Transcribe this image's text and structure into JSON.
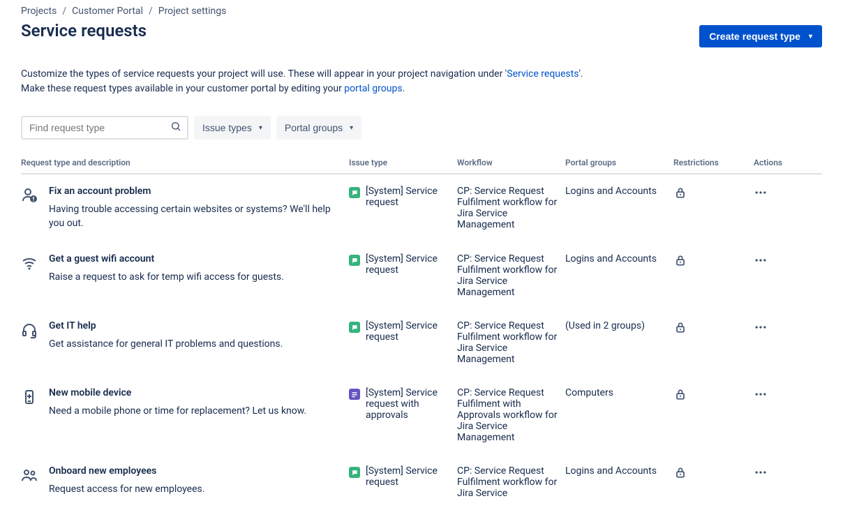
{
  "breadcrumb": {
    "projects": "Projects",
    "portal": "Customer Portal",
    "settings": "Project settings"
  },
  "page": {
    "title": "Service requests",
    "create_button": "Create request type",
    "desc_part1": "Customize the types of service requests your project will use. These will appear in your project navigation under '",
    "desc_link1": "Service requests",
    "desc_part2": "'.",
    "desc_part3": "Make these request types available in your customer portal by editing your ",
    "desc_link2": "portal groups",
    "desc_part4": "."
  },
  "filters": {
    "search_placeholder": "Find request type",
    "issue_types": "Issue types",
    "portal_groups": "Portal groups"
  },
  "columns": {
    "rt": "Request type and description",
    "it": "Issue type",
    "wf": "Workflow",
    "pg": "Portal groups",
    "re": "Restrictions",
    "ac": "Actions"
  },
  "rows": [
    {
      "icon": "person-alert",
      "name": "Fix an account problem",
      "desc": "Having trouble accessing certain websites or systems? We'll help you out.",
      "issue_type": "[System] Service request",
      "issue_color": "green",
      "workflow": "CP: Service Request Fulfilment workflow for Jira Service Management",
      "portal": "Logins and Accounts"
    },
    {
      "icon": "wifi",
      "name": "Get a guest wifi account",
      "desc": "Raise a request to ask for temp wifi access for guests.",
      "issue_type": "[System] Service request",
      "issue_color": "green",
      "workflow": "CP: Service Request Fulfilment workflow for Jira Service Management",
      "portal": "Logins and Accounts"
    },
    {
      "icon": "headset",
      "name": "Get IT help",
      "desc": "Get assistance for general IT problems and questions.",
      "issue_type": "[System] Service request",
      "issue_color": "green",
      "workflow": "CP: Service Request Fulfilment workflow for Jira Service Management",
      "portal": "(Used in 2 groups)"
    },
    {
      "icon": "mobile",
      "name": "New mobile device",
      "desc": "Need a mobile phone or time for replacement? Let us know.",
      "issue_type": "[System] Service request with approvals",
      "issue_color": "purple",
      "workflow": "CP: Service Request Fulfilment with Approvals workflow for Jira Service Management",
      "portal": "Computers"
    },
    {
      "icon": "people",
      "name": "Onboard new employees",
      "desc": "Request access for new employees.",
      "issue_type": "[System] Service request",
      "issue_color": "green",
      "workflow": "CP: Service Request Fulfilment workflow for Jira Service",
      "portal": "Logins and Accounts"
    }
  ]
}
